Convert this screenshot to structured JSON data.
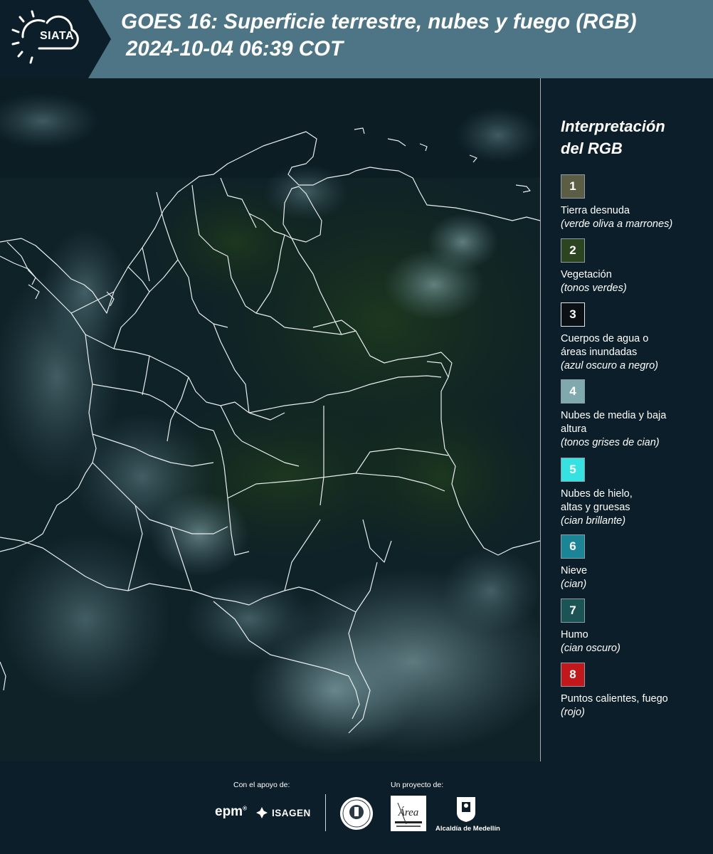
{
  "header": {
    "logo_text": "SIATA",
    "title_line1": "GOES 16: Superficie terrestre, nubes y fuego (RGB)",
    "title_line2": "2024-10-04 06:39 COT"
  },
  "legend": {
    "title_line1": "Interpretación",
    "title_line2": "del RGB",
    "items": [
      {
        "number": "1",
        "label": "Tierra desnuda",
        "sub": "(verde oliva a marrones)",
        "color": "#5b5e44"
      },
      {
        "number": "2",
        "label": "Vegetación",
        "sub": "(tonos verdes)",
        "color": "#2d4420"
      },
      {
        "number": "3",
        "label": "Cuerpos de agua o áreas inundadas",
        "sub": "(azul oscuro a negro)",
        "color": "#0b1015"
      },
      {
        "number": "4",
        "label": "Nubes de media y baja altura",
        "sub": "(tonos grises de cian)",
        "color": "#7fa9ac"
      },
      {
        "number": "5",
        "label": "Nubes de hielo, altas y gruesas",
        "sub": "(cian brillante)",
        "color": "#36e1e1"
      },
      {
        "number": "6",
        "label": "Nieve",
        "sub": "(cian)",
        "color": "#1c8497"
      },
      {
        "number": "7",
        "label": "Humo",
        "sub": "(cian oscuro)",
        "color": "#1c5355"
      },
      {
        "number": "8",
        "label": "Puntos calientes, fuego",
        "sub": "(rojo)",
        "color": "#c0181b"
      }
    ]
  },
  "footer": {
    "support_label": "Con el apoyo de:",
    "project_label": "Un proyecto de:",
    "sponsors": [
      "epm",
      "ISAGEN"
    ],
    "area_logo_text": "Área",
    "alcaldia": "Alcaldía de Medellín"
  }
}
